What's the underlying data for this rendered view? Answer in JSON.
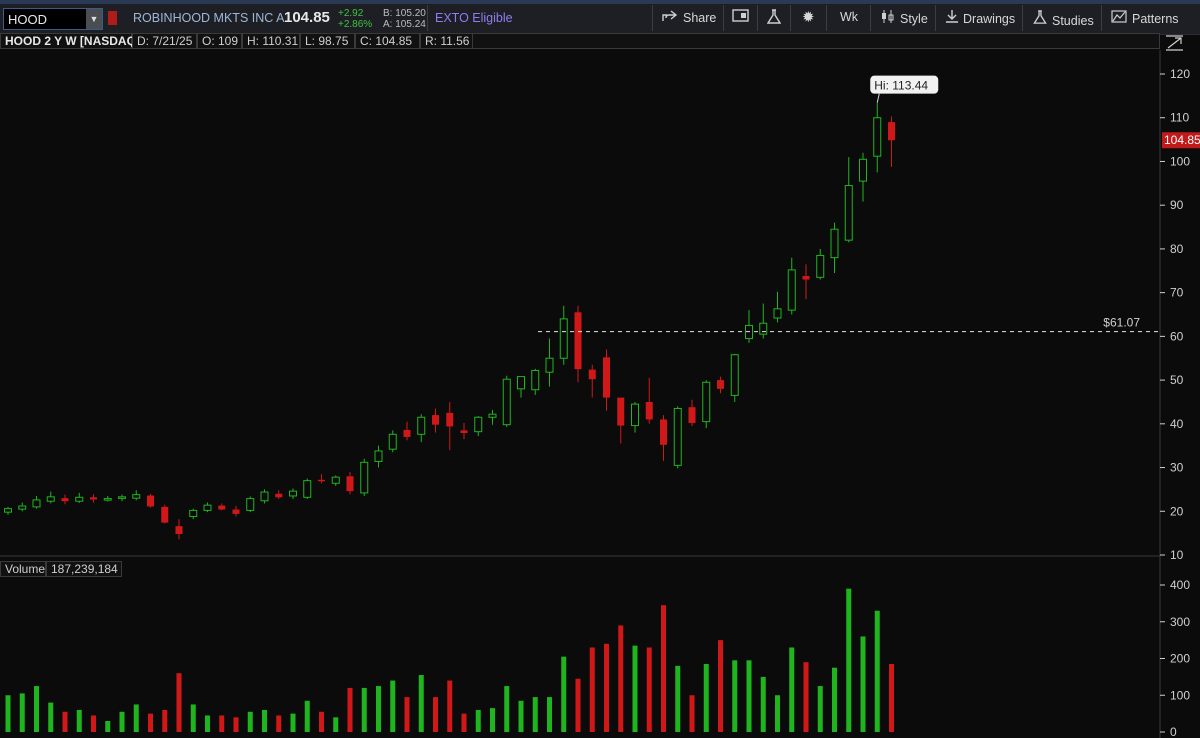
{
  "toolbar": {
    "symbol": "HOOD",
    "company": "ROBINHOOD MKTS INC A",
    "last": "104.85",
    "change": "+2.92",
    "change_pct": "+2.86%",
    "bid": "B: 105.20",
    "ask": "A: 105.24",
    "exto": "EXTO Eligible",
    "share": "Share",
    "period": "Wk",
    "style": "Style",
    "drawings": "Drawings",
    "studies": "Studies",
    "patterns": "Patterns"
  },
  "chart_header": {
    "title": "HOOD 2 Y W [NASDAQ]",
    "date": "D: 7/21/25",
    "open": "O: 109",
    "high": "H: 110.31",
    "low": "L: 98.75",
    "close": "C: 104.85",
    "range": "R: 11.56"
  },
  "hi_label": "Hi: 113.44",
  "price_line_label": "$61.07",
  "last_price_tag": "104.85",
  "volume_header": {
    "label": "Volume",
    "value": "187,239,184"
  },
  "colors": {
    "up": "#1fb51f",
    "down": "#d01818",
    "background": "#0b0b0b"
  },
  "chart_data": [
    {
      "type": "candlestick",
      "title": "HOOD 2 Y W [NASDAQ]",
      "ylim": [
        10,
        125
      ],
      "y_ticks": [
        10,
        20,
        30,
        40,
        50,
        60,
        70,
        80,
        90,
        100,
        110,
        120
      ],
      "horizontal_line": 61.07,
      "high_marker": 113.44,
      "ohlc": [
        [
          19.8,
          21.0,
          19.2,
          20.6
        ],
        [
          20.5,
          22.0,
          20.0,
          21.2
        ],
        [
          21.0,
          23.5,
          20.6,
          22.6
        ],
        [
          22.3,
          24.5,
          21.8,
          23.3
        ],
        [
          23.0,
          23.8,
          21.6,
          22.3
        ],
        [
          22.3,
          24.2,
          21.9,
          23.2
        ],
        [
          23.2,
          23.9,
          22.0,
          22.7
        ],
        [
          22.8,
          23.5,
          22.2,
          22.9
        ],
        [
          23.0,
          23.8,
          22.3,
          23.3
        ],
        [
          23.0,
          24.8,
          22.5,
          23.8
        ],
        [
          23.6,
          24.0,
          20.8,
          21.1
        ],
        [
          21.0,
          21.5,
          17.2,
          17.4
        ],
        [
          16.6,
          18.2,
          13.6,
          14.8
        ],
        [
          18.8,
          20.6,
          18.2,
          20.2
        ],
        [
          20.2,
          22.0,
          19.8,
          21.4
        ],
        [
          21.3,
          21.8,
          20.2,
          20.4
        ],
        [
          20.4,
          21.2,
          18.8,
          19.4
        ],
        [
          20.2,
          23.4,
          19.8,
          22.9
        ],
        [
          22.4,
          25.0,
          21.8,
          24.4
        ],
        [
          24.0,
          24.8,
          22.8,
          23.2
        ],
        [
          23.5,
          25.2,
          22.8,
          24.6
        ],
        [
          23.2,
          27.5,
          22.8,
          27.0
        ],
        [
          27.2,
          28.5,
          26.4,
          26.9
        ],
        [
          26.4,
          28.2,
          25.8,
          27.8
        ],
        [
          28.0,
          29.0,
          23.9,
          24.6
        ],
        [
          24.2,
          32.0,
          23.5,
          31.2
        ],
        [
          31.4,
          35.0,
          30.0,
          33.8
        ],
        [
          34.2,
          38.5,
          33.5,
          37.6
        ],
        [
          38.6,
          40.5,
          36.2,
          37.0
        ],
        [
          37.6,
          42.2,
          35.8,
          41.5
        ],
        [
          42.0,
          43.5,
          38.0,
          39.8
        ],
        [
          42.5,
          45.0,
          34.0,
          39.4
        ],
        [
          38.5,
          40.2,
          36.5,
          37.9
        ],
        [
          38.2,
          41.8,
          37.2,
          41.5
        ],
        [
          41.5,
          43.2,
          39.8,
          42.2
        ],
        [
          39.8,
          51.0,
          39.3,
          50.2
        ],
        [
          48.0,
          50.8,
          46.0,
          50.8
        ],
        [
          47.8,
          52.6,
          46.6,
          52.2
        ],
        [
          51.8,
          59.5,
          48.5,
          55.0
        ],
        [
          55.0,
          67.0,
          53.5,
          64.0
        ],
        [
          65.5,
          67.0,
          49.5,
          52.5
        ],
        [
          52.4,
          53.5,
          46.0,
          50.2
        ],
        [
          55.2,
          57.0,
          43.0,
          46.0
        ],
        [
          46.0,
          41.0,
          35.5,
          39.6
        ],
        [
          39.6,
          45.0,
          38.0,
          44.5
        ],
        [
          45.0,
          50.5,
          40.0,
          41.0
        ],
        [
          41.0,
          42.0,
          31.5,
          35.2
        ],
        [
          30.5,
          44.0,
          29.8,
          43.5
        ],
        [
          43.8,
          45.5,
          39.5,
          40.2
        ],
        [
          40.5,
          50.0,
          39.0,
          49.5
        ],
        [
          50.0,
          50.8,
          47.0,
          48.0
        ],
        [
          46.5,
          56.0,
          45.0,
          55.8
        ],
        [
          59.5,
          66.0,
          58.5,
          62.5
        ],
        [
          60.5,
          67.5,
          59.5,
          63.0
        ],
        [
          64.2,
          70.2,
          63.2,
          66.3
        ],
        [
          66.0,
          78.0,
          65.0,
          75.2
        ],
        [
          73.8,
          76.5,
          68.5,
          73.0
        ],
        [
          73.5,
          80.0,
          73.0,
          78.5
        ],
        [
          78.0,
          86.0,
          74.5,
          84.5
        ],
        [
          82.0,
          101.0,
          81.5,
          94.5
        ],
        [
          95.5,
          102.0,
          90.8,
          100.5
        ],
        [
          101.2,
          113.44,
          97.5,
          110.0
        ],
        [
          109.0,
          110.31,
          98.75,
          104.85
        ]
      ],
      "volume_ylim": [
        0,
        400
      ],
      "volume_ticks": [
        0,
        100,
        200,
        300,
        400
      ],
      "volume": [
        100,
        105,
        125,
        80,
        55,
        60,
        45,
        30,
        55,
        75,
        50,
        60,
        160,
        75,
        45,
        45,
        40,
        55,
        60,
        45,
        50,
        85,
        55,
        40,
        120,
        120,
        125,
        140,
        95,
        155,
        95,
        140,
        50,
        60,
        65,
        125,
        85,
        95,
        95,
        205,
        145,
        230,
        240,
        290,
        235,
        230,
        345,
        180,
        100,
        185,
        250,
        195,
        195,
        150,
        100,
        230,
        190,
        125,
        175,
        390,
        260,
        330,
        185
      ]
    }
  ]
}
